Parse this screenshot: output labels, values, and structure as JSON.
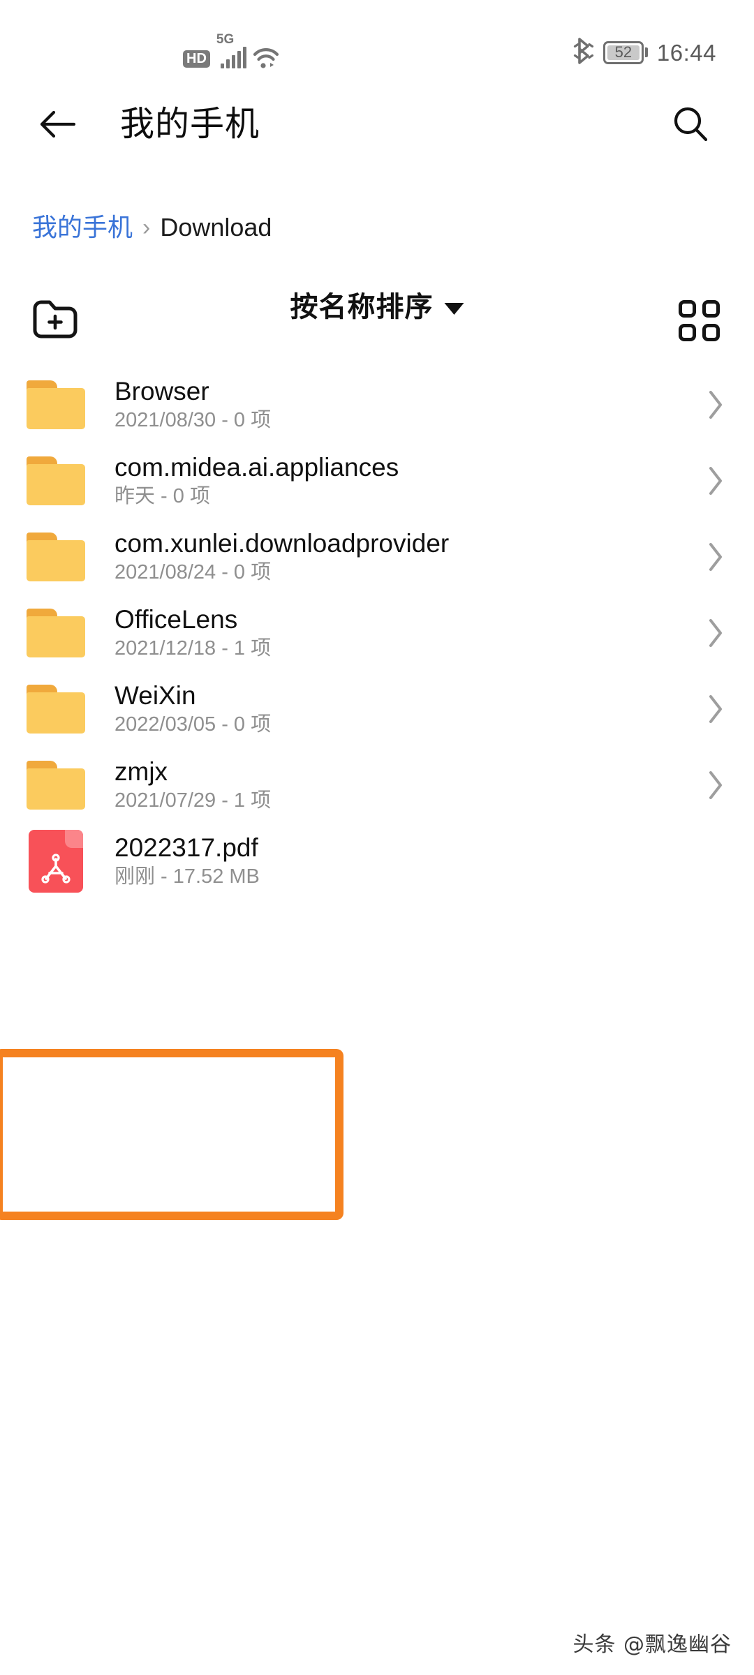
{
  "status_bar": {
    "hd_label": "HD",
    "network_label": "5G",
    "signal_icon": "signal-bars-icon",
    "wifi_icon": "wifi-icon",
    "bluetooth_icon": "bluetooth-icon",
    "battery_level": "52",
    "clock": "16:44"
  },
  "app_bar": {
    "back_icon": "back-arrow-icon",
    "title": "我的手机",
    "search_icon": "search-icon"
  },
  "breadcrumb": {
    "root": "我的手机",
    "separator": "›",
    "current": "Download"
  },
  "toolbar": {
    "new_folder_icon": "new-folder-icon",
    "sort_label": "按名称排序",
    "sort_caret_icon": "chevron-down-icon",
    "grid_view_icon": "grid-view-icon"
  },
  "files": [
    {
      "name": "Browser",
      "meta": "2021/08/30 - 0 项",
      "type": "folder",
      "icon": "folder-icon"
    },
    {
      "name": "com.midea.ai.appliances",
      "meta": "昨天 - 0 项",
      "type": "folder",
      "icon": "folder-icon"
    },
    {
      "name": "com.xunlei.downloadprovider",
      "meta": "2021/08/24 - 0 项",
      "type": "folder",
      "icon": "folder-icon"
    },
    {
      "name": "OfficeLens",
      "meta": "2021/12/18 - 1 项",
      "type": "folder",
      "icon": "folder-icon"
    },
    {
      "name": "WeiXin",
      "meta": "2022/03/05 - 0 项",
      "type": "folder",
      "icon": "folder-icon"
    },
    {
      "name": "zmjx",
      "meta": "2021/07/29 - 1 项",
      "type": "folder",
      "icon": "folder-icon"
    },
    {
      "name": "2022317.pdf",
      "meta": "刚刚 - 17.52 MB",
      "type": "pdf",
      "icon": "pdf-file-icon"
    }
  ],
  "highlight": {
    "color": "#f58220",
    "target": "2022317.pdf"
  },
  "watermark": "头条 @飘逸幽谷",
  "colors": {
    "breadcrumb_link": "#3a74d8",
    "folder_body": "#fbcb5e",
    "folder_tab": "#f0a93c",
    "pdf_red": "#f85158",
    "highlight_orange": "#f58220",
    "meta_gray": "#8f8f8f"
  }
}
